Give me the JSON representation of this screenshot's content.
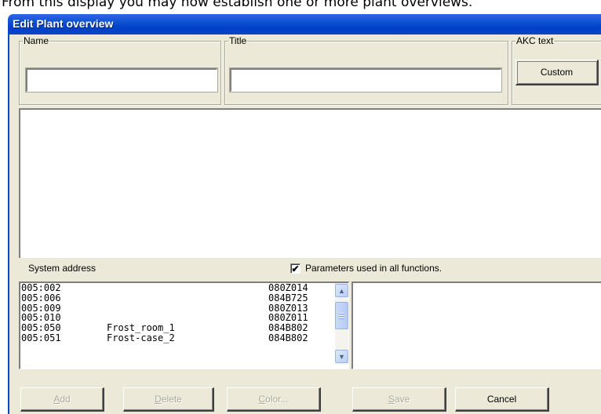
{
  "caption": "From this display you may now establish one or more plant overviews.",
  "window": {
    "title": "Edit Plant overview"
  },
  "groups": {
    "name_label": "Name",
    "title_label": "Title",
    "akc_label": "AKC text"
  },
  "fields": {
    "name_value": "",
    "title_value": ""
  },
  "custom_button": "Custom",
  "system_address_label": "System address",
  "parameters_checkbox": {
    "label": "Parameters used in all functions.",
    "checked": "✔"
  },
  "system_list": [
    {
      "addr": "005:002",
      "name": "",
      "code": "080Z014"
    },
    {
      "addr": "005:006",
      "name": "",
      "code": "084B725"
    },
    {
      "addr": "005:009",
      "name": "",
      "code": "080Z013"
    },
    {
      "addr": "005:010",
      "name": "",
      "code": "080Z011"
    },
    {
      "addr": "005:050",
      "name": "Frost_room_1",
      "code": "084B802"
    },
    {
      "addr": "005:051",
      "name": "Frost-case_2",
      "code": "084B802"
    }
  ],
  "buttons": {
    "add": {
      "first": "A",
      "rest": "dd"
    },
    "delete": {
      "first": "D",
      "rest": "elete"
    },
    "color": {
      "first": "C",
      "rest": "olor..."
    },
    "save": {
      "first": "S",
      "rest": "ave"
    },
    "cancel": "Cancel"
  },
  "icons": {
    "scroll_up": "chevron-up-icon",
    "scroll_down": "chevron-down-icon",
    "checkbox": "checkmark-icon"
  },
  "colors": {
    "titlebar": "#0a4ecf",
    "window_bg": "#ece9d8",
    "disabled_text": "#aca899"
  }
}
